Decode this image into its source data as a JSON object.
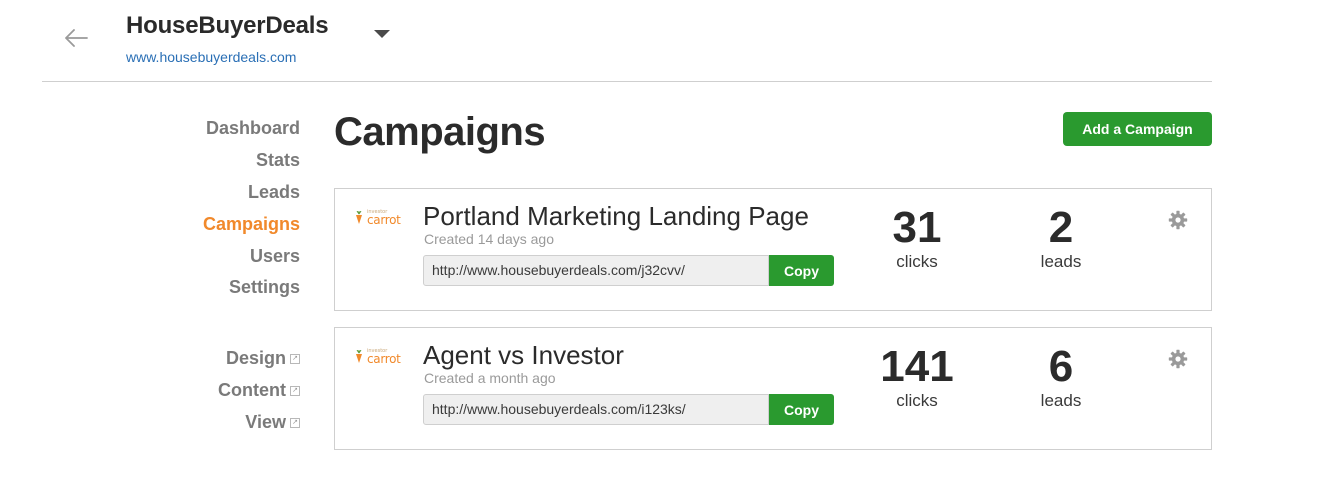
{
  "header": {
    "title": "HouseBuyerDeals",
    "url": "www.housebuyerdeals.com",
    "back_icon": "arrow-left-icon",
    "dropdown_icon": "caret-down-icon"
  },
  "nav": {
    "items": [
      {
        "label": "Dashboard"
      },
      {
        "label": "Stats"
      },
      {
        "label": "Leads"
      },
      {
        "label": "Campaigns",
        "active": true
      },
      {
        "label": "Users"
      },
      {
        "label": "Settings"
      }
    ],
    "external_items": [
      {
        "label": "Design"
      },
      {
        "label": "Content"
      },
      {
        "label": "View"
      }
    ],
    "external_icon": "external-link-icon"
  },
  "page": {
    "title": "Campaigns",
    "add_button": "Add a Campaign"
  },
  "campaigns": [
    {
      "logo_small": "investor",
      "logo_word": "carrot",
      "name": "Portland Marketing Landing Page",
      "created": "Created 14 days ago",
      "url": "http://www.housebuyerdeals.com/j32cvv/",
      "copy_label": "Copy",
      "clicks": "31",
      "clicks_label": "clicks",
      "leads": "2",
      "leads_label": "leads"
    },
    {
      "logo_small": "investor",
      "logo_word": "carrot",
      "name": "Agent vs Investor",
      "created": "Created a month ago",
      "url": "http://www.housebuyerdeals.com/i123ks/",
      "copy_label": "Copy",
      "clicks": "141",
      "clicks_label": "clicks",
      "leads": "6",
      "leads_label": "leads"
    }
  ],
  "colors": {
    "accent": "#f1892b",
    "button_green": "#2a9a2f",
    "link_blue": "#2a6fb5"
  }
}
